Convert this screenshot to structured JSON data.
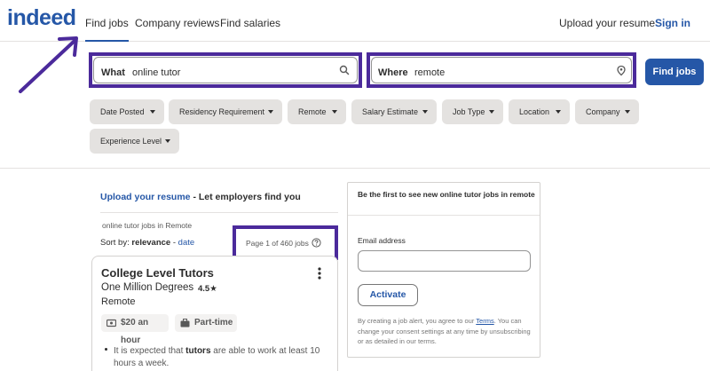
{
  "header": {
    "logo": "indeed",
    "nav": [
      "Find jobs",
      "Company reviews",
      "Find salaries"
    ],
    "upload_resume": "Upload your resume",
    "sign_in": "Sign in"
  },
  "search": {
    "what_label": "What",
    "what_value": "online tutor",
    "where_label": "Where",
    "where_value": "remote",
    "find_button": "Find jobs"
  },
  "filters": [
    "Date Posted",
    "Residency Requirement",
    "Remote",
    "Salary Estimate",
    "Job Type",
    "Location",
    "Company",
    "Experience Level"
  ],
  "results": {
    "upload_link": "Upload your resume",
    "upload_rest": " - Let employers find you",
    "context": "online tutor jobs in Remote",
    "sort_label": "Sort by: ",
    "sort_relevance": "relevance",
    "sort_sep": " - ",
    "sort_date": "date",
    "page_count": "Page 1 of 460 jobs"
  },
  "job": {
    "title": "College Level Tutors",
    "company": "One Million Degrees",
    "rating": "4.5★",
    "location": "Remote",
    "salary": "$20 an hour",
    "job_type": "Part-time",
    "snippet_pre": "It is expected that ",
    "snippet_bold": "tutors",
    "snippet_post": " are able to work at least 10 hours a week."
  },
  "alert": {
    "heading": "Be the first to see new online tutor jobs in remote",
    "email_label": "Email address",
    "email_value": "",
    "activate": "Activate",
    "consent_pre": "By creating a job alert, you agree to our ",
    "consent_terms": "Terms",
    "consent_post": ". You can change your consent settings at any time by unsubscribing or as detailed in our terms."
  },
  "colors": {
    "brand_blue": "#2557a7",
    "annotation_purple": "#4b2a9b",
    "chip_gray": "#e4e2e0"
  }
}
